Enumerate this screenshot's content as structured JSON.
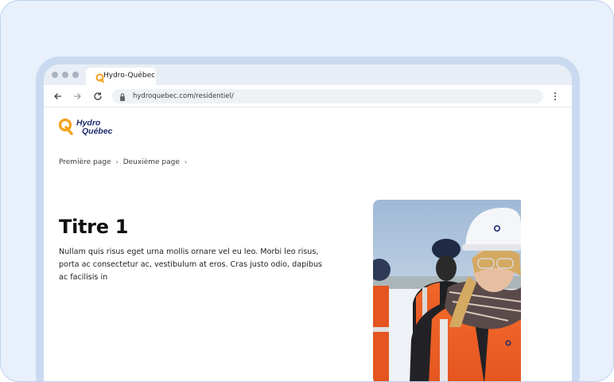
{
  "browser": {
    "tab_title": "Hydro-Québec",
    "url": "hydroquebec.com/residentiel/"
  },
  "site": {
    "logo_line1": "Hydro",
    "logo_line2": "Québec"
  },
  "breadcrumb": {
    "items": [
      "Première page",
      "Deuxième page"
    ]
  },
  "main": {
    "title": "Titre 1",
    "description": "Nullam quis risus eget urna mollis ornare vel eu leo. Morbi leo risus, porta ac consectetur ac, vestibulum at eros. Cras justo odio, dapibus ac facilisis in"
  },
  "colors": {
    "brand_orange": "#f4a21b",
    "brand_navy": "#1e2a6e",
    "frame": "#c9daf0",
    "background": "#e8f0fb"
  },
  "icons": [
    "back-arrow-icon",
    "forward-arrow-icon",
    "reload-icon",
    "lock-icon",
    "more-vert-icon"
  ]
}
